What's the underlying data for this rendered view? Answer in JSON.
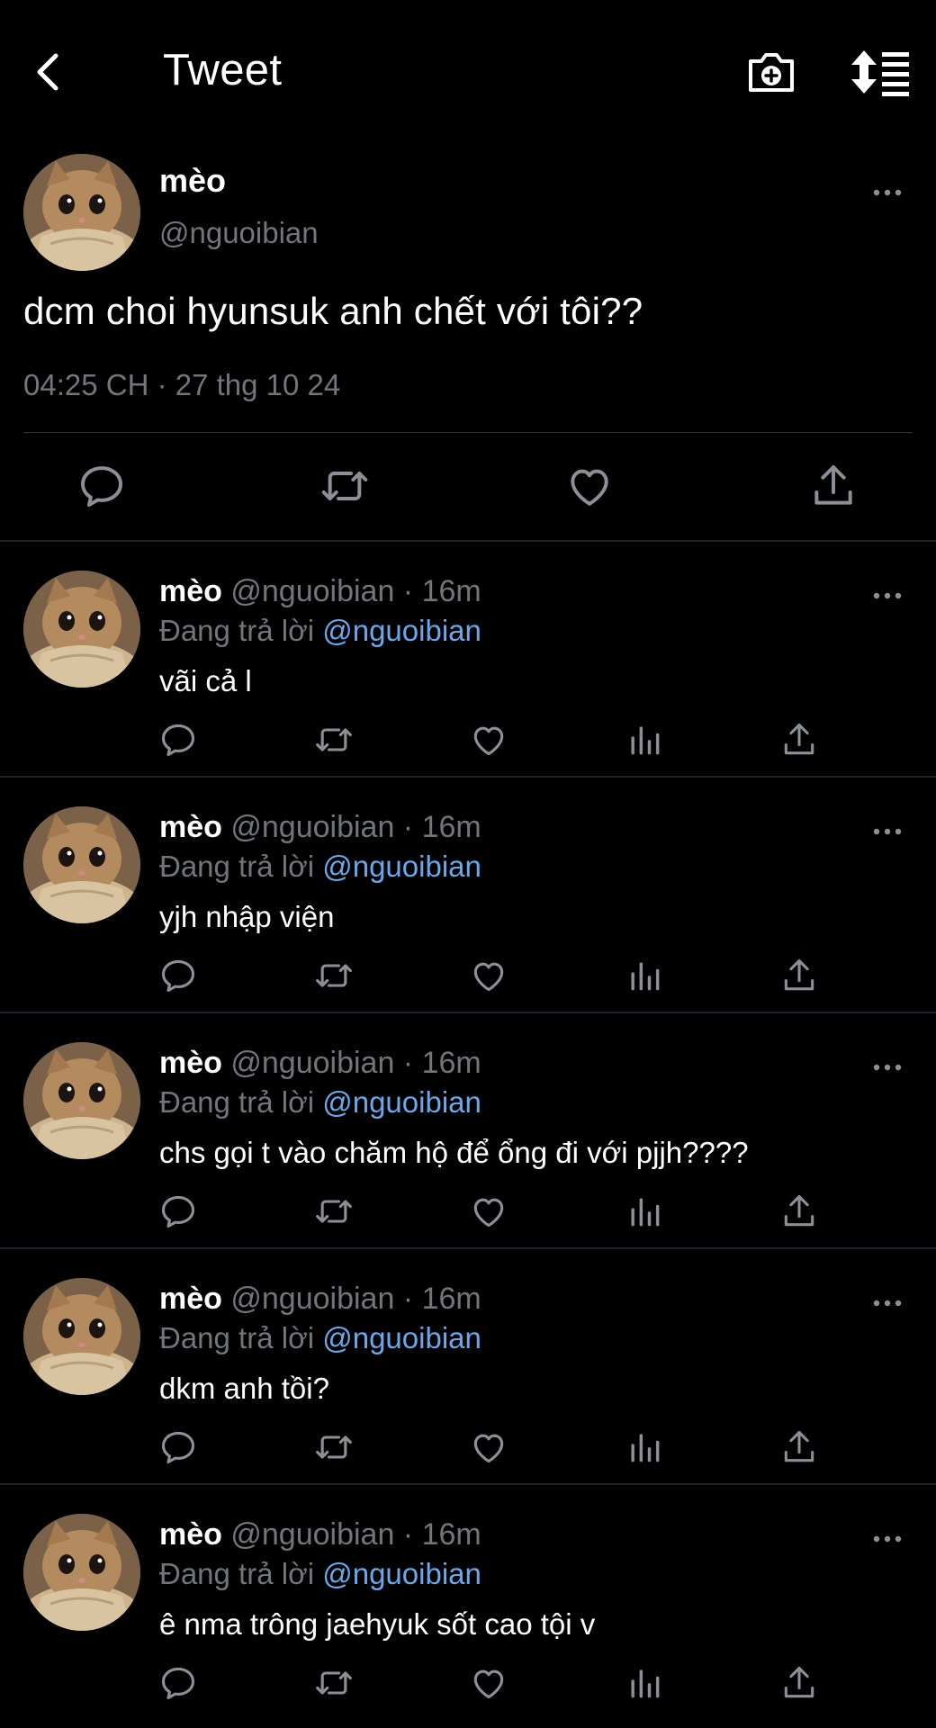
{
  "header": {
    "title": "Tweet"
  },
  "icons": {
    "back": "chevron-left-icon",
    "camera": "camera-plus-icon",
    "sort": "sort-list-icon",
    "reply": "reply-icon",
    "retweet": "retweet-icon",
    "like": "heart-icon",
    "views": "bar-chart-icon",
    "share": "share-icon",
    "more": "more-dots-icon"
  },
  "colors": {
    "background": "#000000",
    "text": "#ffffff",
    "muted": "#71767b",
    "mention": "#6aa8ea"
  },
  "main_tweet": {
    "name": "mèo",
    "handle": "@nguoibian",
    "text": "dcm choi hyunsuk anh chết với tôi??",
    "timestamp": "04:25 CH · 27 thg 10 24"
  },
  "replies": [
    {
      "name": "mèo",
      "meta": "@nguoibian · 16m",
      "replying_prefix": "Đang trả lời ",
      "mention": "@nguoibian",
      "text": "vãi cả l"
    },
    {
      "name": "mèo",
      "meta": "@nguoibian · 16m",
      "replying_prefix": "Đang trả lời ",
      "mention": "@nguoibian",
      "text": "yjh nhập viện"
    },
    {
      "name": "mèo",
      "meta": "@nguoibian · 16m",
      "replying_prefix": "Đang trả lời ",
      "mention": "@nguoibian",
      "text": "chs gọi t vào chăm hộ để ổng đi với pjjh????"
    },
    {
      "name": "mèo",
      "meta": "@nguoibian · 16m",
      "replying_prefix": "Đang trả lời ",
      "mention": "@nguoibian",
      "text": "dkm anh tồi?"
    },
    {
      "name": "mèo",
      "meta": "@nguoibian · 16m",
      "replying_prefix": "Đang trả lời ",
      "mention": "@nguoibian",
      "text": "ê nma trông jaehyuk sốt cao tội v"
    }
  ]
}
